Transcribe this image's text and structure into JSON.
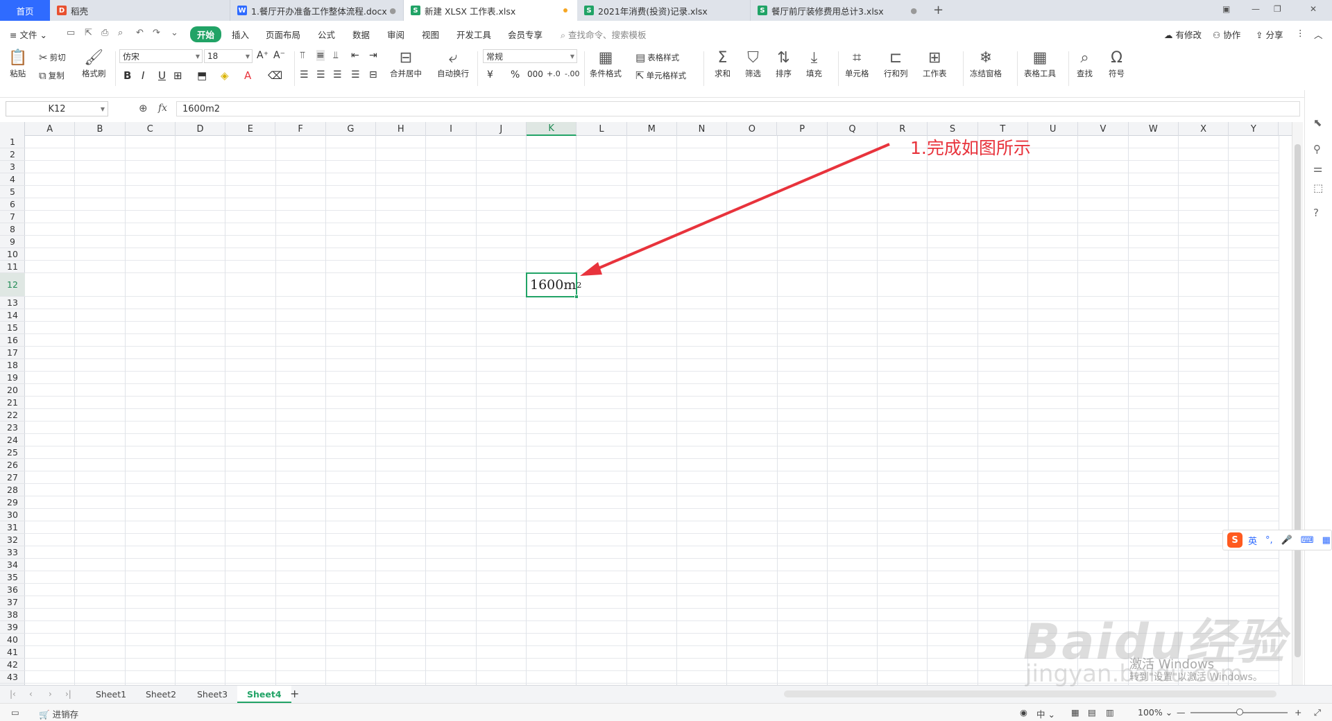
{
  "tabs": {
    "home": "首页",
    "daoke": "稻壳",
    "doc1": "1.餐厅开办准备工作整体流程.docx",
    "active": "新建 XLSX 工作表.xlsx",
    "doc3": "2021年消费(投资)记录.xlsx",
    "doc4": "餐厅前厅装修费用总计3.xlsx"
  },
  "menu": {
    "file": "文件",
    "start": "开始",
    "insert": "插入",
    "page_layout": "页面布局",
    "formula": "公式",
    "data": "数据",
    "review": "审阅",
    "view": "视图",
    "dev_tools": "开发工具",
    "vip": "会员专享",
    "search_placeholder": "查找命令、搜索模板",
    "has_changes": "有修改",
    "collab": "协作",
    "share": "分享"
  },
  "ribbon": {
    "paste": "粘贴",
    "cut": "剪切",
    "copy": "复制",
    "format_painter": "格式刷",
    "font_name": "仿宋",
    "font_size": "18",
    "merge_center": "合并居中",
    "wrap_text": "自动换行",
    "number_format": "常规",
    "cond_format": "条件格式",
    "table_style": "表格样式",
    "cell_style": "单元格样式",
    "sum": "求和",
    "filter": "筛选",
    "sort": "排序",
    "fill": "填充",
    "cell": "单元格",
    "row_col": "行和列",
    "worksheet": "工作表",
    "freeze": "冻结窗格",
    "table_tools": "表格工具",
    "find": "查找",
    "symbol": "符号"
  },
  "formula_bar": {
    "name_box": "K12",
    "fx": "fx",
    "content": "1600m2"
  },
  "grid": {
    "columns": [
      "A",
      "B",
      "C",
      "D",
      "E",
      "F",
      "G",
      "H",
      "I",
      "J",
      "K",
      "L",
      "M",
      "N",
      "O",
      "P",
      "Q",
      "R",
      "S",
      "T",
      "U",
      "V",
      "W",
      "X",
      "Y"
    ],
    "selected_column": "K",
    "selected_row": 12,
    "row_count": 43,
    "selected_cell": {
      "base": "1600m",
      "superscript": "2"
    }
  },
  "annotation": "1.完成如图所示",
  "sheets": [
    "Sheet1",
    "Sheet2",
    "Sheet3",
    "Sheet4"
  ],
  "active_sheet": "Sheet4",
  "status": {
    "invoicing": "进销存",
    "lang": "中",
    "zoom": "100%"
  },
  "ime": {
    "lang": "英",
    "punct": "°,"
  },
  "watermarks": {
    "baidu": "Baidu经验",
    "jingyan": "jingyan.baidu.com",
    "activate_title": "激活 Windows",
    "activate_sub": "转到\"设置\"以激活 Windows。"
  },
  "colors": {
    "accent": "#21a366",
    "annotation": "#e8333c",
    "home_tab": "#2f6bff"
  }
}
